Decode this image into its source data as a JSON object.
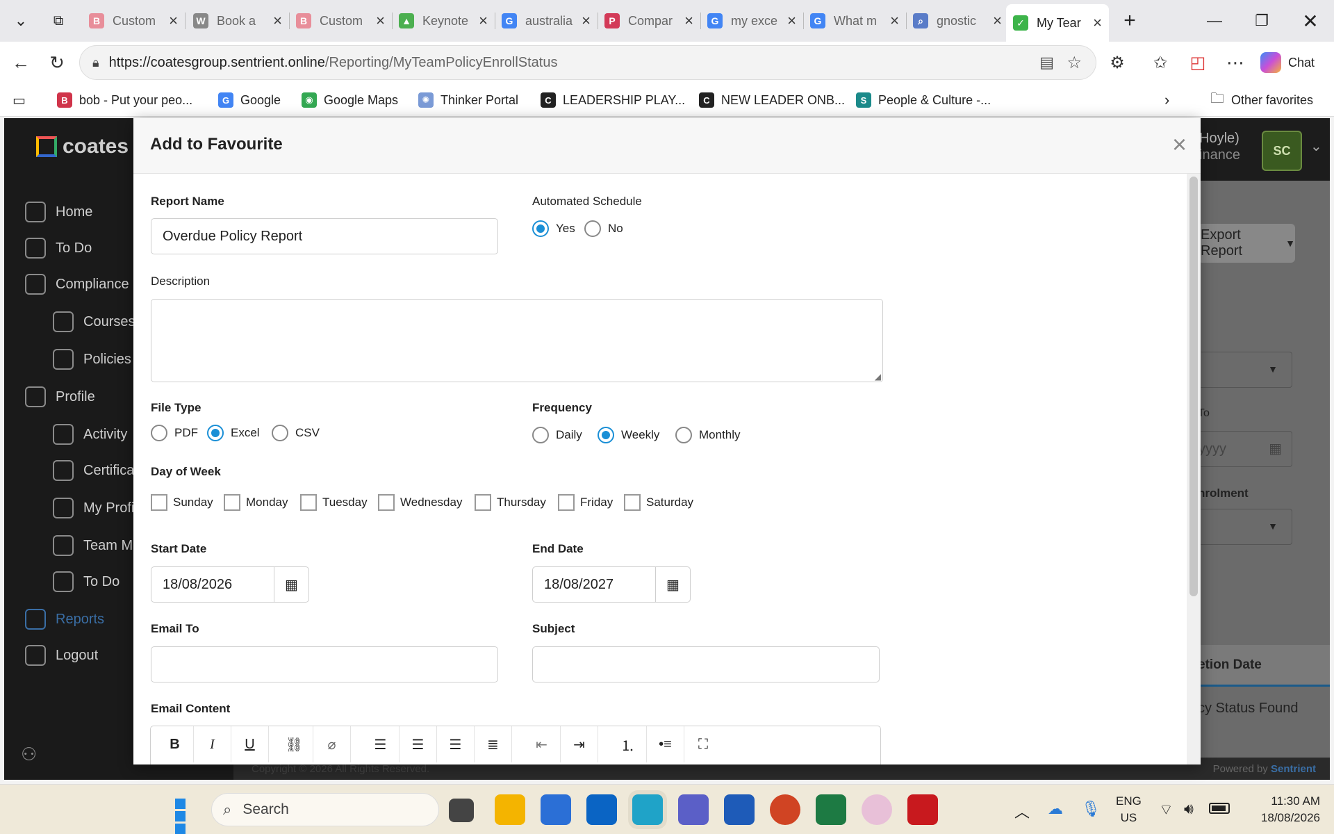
{
  "browser": {
    "tabs": [
      {
        "title": "Custom",
        "icon_letter": "B",
        "icon_color": "#e88e9a"
      },
      {
        "title": "Book a",
        "icon_letter": "W",
        "icon_color": "#888888"
      },
      {
        "title": "Custom",
        "icon_letter": "B",
        "icon_color": "#e88e9a"
      },
      {
        "title": "Keynote",
        "icon_letter": "▲",
        "icon_color": "#4caf50"
      },
      {
        "title": "australia",
        "icon_letter": "G",
        "icon_color": "#4285f4"
      },
      {
        "title": "Compar",
        "icon_letter": "P",
        "icon_color": "#d33a58"
      },
      {
        "title": "my exce",
        "icon_letter": "G",
        "icon_color": "#4285f4"
      },
      {
        "title": "What m",
        "icon_letter": "G",
        "icon_color": "#4285f4"
      },
      {
        "title": "gnostic",
        "icon_letter": "⌕",
        "icon_color": "#5a7cc8"
      },
      {
        "title": "My Tear",
        "icon_letter": "✓",
        "icon_color": "#3db44a"
      }
    ],
    "url_host": "https://coatesgroup.sentrient.online",
    "url_path": "/Reporting/MyTeamPolicyEnrollStatus",
    "chat_label": "Chat",
    "bookmarks": [
      {
        "label": "bob - Put your peo...",
        "icon_letter": "B",
        "icon_color": "#d0344a"
      },
      {
        "label": "Google",
        "icon_letter": "G",
        "icon_color": "#4285f4"
      },
      {
        "label": "Google Maps",
        "icon_letter": "◉",
        "icon_color": "#34a853"
      },
      {
        "label": "Thinker Portal",
        "icon_letter": "✺",
        "icon_color": "#7a9ad6"
      },
      {
        "label": "LEADERSHIP PLAY...",
        "icon_letter": "C",
        "icon_color": "#222222"
      },
      {
        "label": "NEW LEADER ONB...",
        "icon_letter": "C",
        "icon_color": "#222222"
      },
      {
        "label": "People & Culture -...",
        "icon_letter": "S",
        "icon_color": "#1b8a8a"
      }
    ],
    "other_favorites": "Other favorites"
  },
  "app": {
    "logo_text": "coates",
    "user_name": "Hoyle)",
    "user_dept": "inance",
    "avatar_initials": "SC",
    "nav": [
      {
        "label": "Home",
        "indent": false
      },
      {
        "label": "To Do",
        "indent": false
      },
      {
        "label": "Compliance",
        "indent": false
      },
      {
        "label": "Courses",
        "indent": true
      },
      {
        "label": "Policies",
        "indent": true
      },
      {
        "label": "Profile",
        "indent": false
      },
      {
        "label": "Activity",
        "indent": true
      },
      {
        "label": "Certifica",
        "indent": true
      },
      {
        "label": "My Profi",
        "indent": true
      },
      {
        "label": "Team M",
        "indent": true
      },
      {
        "label": "To Do",
        "indent": true
      },
      {
        "label": "Reports",
        "indent": false
      },
      {
        "label": "Logout",
        "indent": false
      }
    ],
    "export_report": "Export Report",
    "to_label": "To",
    "date_placeholder_fragment": "yyyy",
    "enrolment_label": "nrolment",
    "column_header": "etion Date",
    "no_data": "cy Status Found",
    "powered_by": "Powered by",
    "powered_brand": "Sentrient",
    "copyright": "Copyright © 2026 All Rights Reserved."
  },
  "modal": {
    "title": "Add to Favourite",
    "report_name_label": "Report Name",
    "report_name_value": "Overdue Policy Report",
    "automated_schedule_label": "Automated Schedule",
    "schedule_options": [
      "Yes",
      "No"
    ],
    "schedule_selected": "Yes",
    "description_label": "Description",
    "description_value": "",
    "file_type_label": "File Type",
    "file_types": [
      "PDF",
      "Excel",
      "CSV"
    ],
    "file_type_selected": "Excel",
    "frequency_label": "Frequency",
    "frequencies": [
      "Daily",
      "Weekly",
      "Monthly"
    ],
    "frequency_selected": "Weekly",
    "day_of_week_label": "Day of Week",
    "days": [
      "Sunday",
      "Monday",
      "Tuesday",
      "Wednesday",
      "Thursday",
      "Friday",
      "Saturday"
    ],
    "start_date_label": "Start Date",
    "start_date_value": "18/08/2026",
    "end_date_label": "End Date",
    "end_date_value": "18/08/2027",
    "email_to_label": "Email To",
    "email_to_value": "",
    "subject_label": "Subject",
    "subject_value": "",
    "email_content_label": "Email Content",
    "editor_tools": [
      "bold",
      "italic",
      "underline",
      "link",
      "unlink",
      "align-left",
      "align-center",
      "align-right",
      "justify",
      "outdent",
      "indent",
      "ordered-list",
      "bullet-list",
      "fullscreen"
    ]
  },
  "taskbar": {
    "search_placeholder": "Search",
    "lang_top": "ENG",
    "lang_bottom": "US",
    "time": "11:30 AM",
    "date": "18/08/2026"
  }
}
